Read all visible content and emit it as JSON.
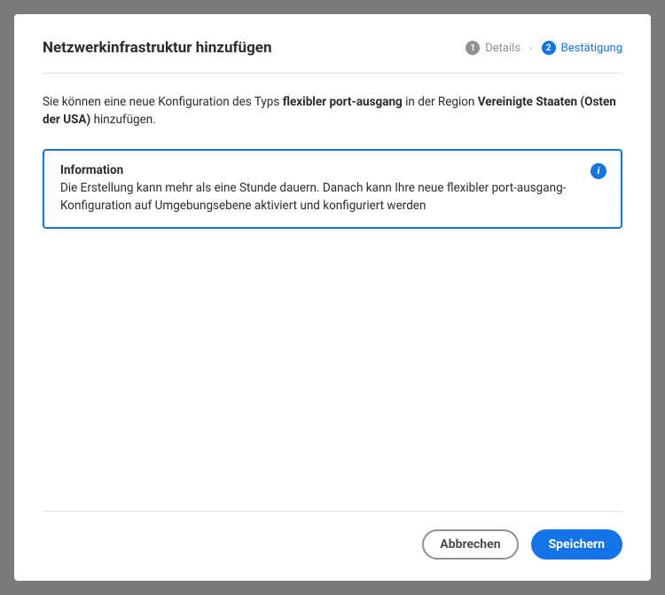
{
  "dialog": {
    "title": "Netzwerkinfrastruktur hinzufügen"
  },
  "steps": {
    "step1": {
      "number": "1",
      "label": "Details"
    },
    "step2": {
      "number": "2",
      "label": "Bestätigung"
    }
  },
  "description": {
    "prefix": "Sie können eine neue Konfiguration des Typs ",
    "type": "flexibler port-ausgang",
    "mid": " in der Region ",
    "region": "Vereinigte Staaten (Osten der USA)",
    "suffix": " hinzufügen."
  },
  "info": {
    "title": "Information",
    "text": "Die Erstellung kann mehr als eine Stunde dauern. Danach kann Ihre neue flexibler port-ausgang-Konfiguration auf Umgebungsebene aktiviert und konfiguriert werden",
    "icon": "i"
  },
  "actions": {
    "cancel": "Abbrechen",
    "save": "Speichern"
  }
}
